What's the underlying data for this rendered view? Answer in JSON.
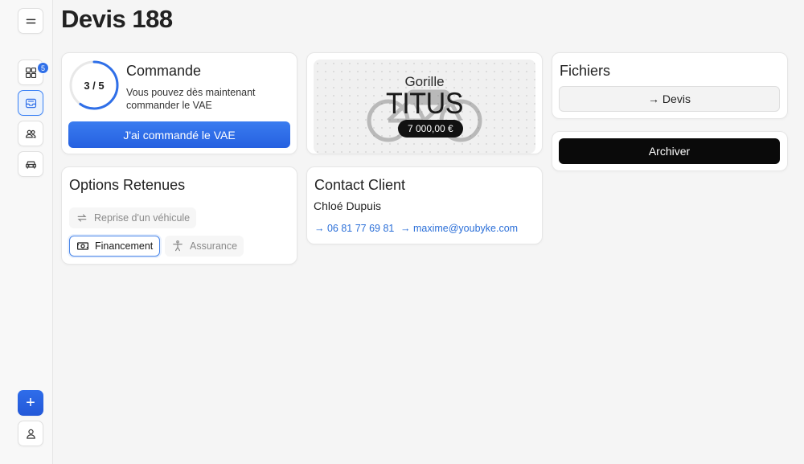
{
  "page": {
    "title": "Devis 188"
  },
  "sidebar": {
    "menu_icon": "hamburger-icon",
    "items": [
      {
        "name": "dashboard",
        "icon": "grid-icon",
        "badge": "5",
        "active": false
      },
      {
        "name": "devis",
        "icon": "inbox-icon",
        "active": true
      },
      {
        "name": "clients",
        "icon": "users-icon",
        "active": false
      },
      {
        "name": "vehicles",
        "icon": "car-icon",
        "active": false
      }
    ],
    "add_label": "+",
    "profile_icon": "user-icon"
  },
  "commande": {
    "title": "Commande",
    "progress_text": "3 / 5",
    "progress": {
      "current": 3,
      "total": 5
    },
    "description": "Vous pouvez dès maintenant commander le VAE",
    "button_label": "J'ai commandé le VAE"
  },
  "bike": {
    "brand": "Gorille",
    "model": "TITUS",
    "price": "7 000,00 €"
  },
  "fichiers": {
    "title": "Fichiers",
    "devis_label": "→ Devis"
  },
  "archive": {
    "button_label": "Archiver"
  },
  "options": {
    "title": "Options Retenues",
    "items": [
      {
        "label": "Reprise d'un véhicule",
        "icon": "swap-icon",
        "selected": false
      },
      {
        "label": "Financement",
        "icon": "money-icon",
        "selected": true
      },
      {
        "label": "Assurance",
        "icon": "accessibility-icon",
        "selected": false
      }
    ]
  },
  "contact": {
    "title": "Contact Client",
    "name": "Chloé Dupuis",
    "phone": "→ 06 81 77 69 81",
    "email": "→ maxime@youbyke.com"
  },
  "colors": {
    "accent": "#2f6fe8",
    "dark": "#0a0a0a"
  }
}
